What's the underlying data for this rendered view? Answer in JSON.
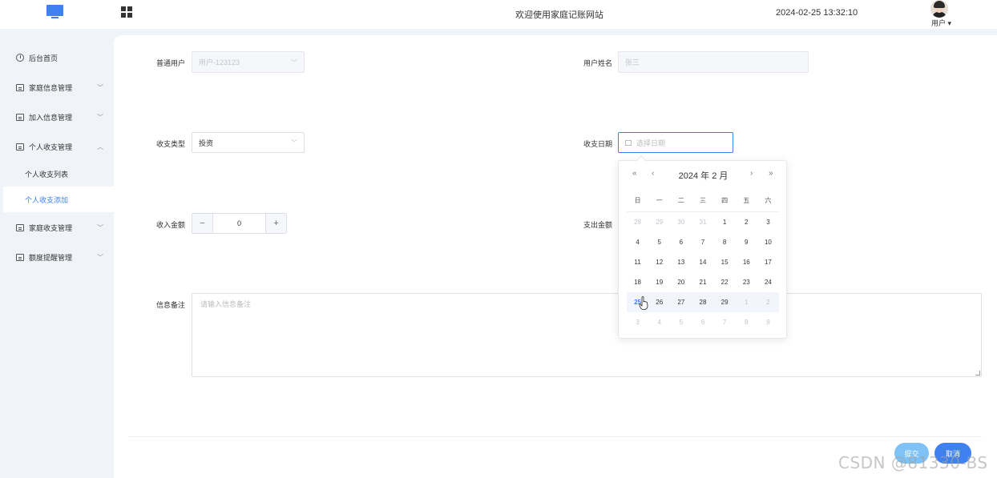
{
  "header": {
    "welcome": "欢迎使用家庭记账网站",
    "datetime": "2024-02-25 13:32:10",
    "user_label": "用户 ▾"
  },
  "sidebar": {
    "items": [
      {
        "label": "后台首页",
        "icon": "clock-icon"
      },
      {
        "label": "家庭信息管理",
        "icon": "card-icon",
        "chevron": "﹀"
      },
      {
        "label": "加入信息管理",
        "icon": "card-icon",
        "chevron": "﹀"
      },
      {
        "label": "个人收支管理",
        "icon": "card-icon",
        "chevron": "︿"
      },
      {
        "label": "家庭收支管理",
        "icon": "card-icon",
        "chevron": "﹀"
      },
      {
        "label": "额度提醒管理",
        "icon": "card-icon",
        "chevron": "﹀"
      }
    ],
    "subitems": [
      {
        "label": "个人收支列表",
        "active": false
      },
      {
        "label": "个人收支添加",
        "active": true
      }
    ]
  },
  "form": {
    "user_label": "普通用户",
    "user_value": "用户-123123",
    "name_label": "用户姓名",
    "name_value": "张三",
    "type_label": "收支类型",
    "type_value": "投资",
    "date_label": "收支日期",
    "date_placeholder": "选择日期",
    "income_label": "收入金额",
    "income_value": "0",
    "income_minus": "−",
    "income_plus": "+",
    "expense_label": "支出金额",
    "note_label": "信息备注",
    "note_placeholder": "请输入信息备注",
    "submit_label": "提交",
    "cancel_label": "取消"
  },
  "datepicker": {
    "header": "2024 年  2 月",
    "nav": {
      "prev_year": "«",
      "prev_month": "‹",
      "next_month": "›",
      "next_year": "»"
    },
    "weekdays": [
      "日",
      "一",
      "二",
      "三",
      "四",
      "五",
      "六"
    ],
    "weeks": [
      [
        [
          "28",
          "prev"
        ],
        [
          "29",
          "prev"
        ],
        [
          "30",
          "prev"
        ],
        [
          "31",
          "prev"
        ],
        [
          "1",
          "cur"
        ],
        [
          "2",
          "cur"
        ],
        [
          "3",
          "cur"
        ]
      ],
      [
        [
          "4",
          "cur"
        ],
        [
          "5",
          "cur"
        ],
        [
          "6",
          "cur"
        ],
        [
          "7",
          "cur"
        ],
        [
          "8",
          "cur"
        ],
        [
          "9",
          "cur"
        ],
        [
          "10",
          "cur"
        ]
      ],
      [
        [
          "11",
          "cur"
        ],
        [
          "12",
          "cur"
        ],
        [
          "13",
          "cur"
        ],
        [
          "14",
          "cur"
        ],
        [
          "15",
          "cur"
        ],
        [
          "16",
          "cur"
        ],
        [
          "17",
          "cur"
        ]
      ],
      [
        [
          "18",
          "cur"
        ],
        [
          "19",
          "cur"
        ],
        [
          "20",
          "cur"
        ],
        [
          "21",
          "cur"
        ],
        [
          "22",
          "cur"
        ],
        [
          "23",
          "cur"
        ],
        [
          "24",
          "cur"
        ]
      ],
      [
        [
          "25",
          "today"
        ],
        [
          "26",
          "cur"
        ],
        [
          "27",
          "cur"
        ],
        [
          "28",
          "cur"
        ],
        [
          "29",
          "cur"
        ],
        [
          "1",
          "next"
        ],
        [
          "2",
          "next"
        ]
      ],
      [
        [
          "3",
          "next"
        ],
        [
          "4",
          "next"
        ],
        [
          "5",
          "next"
        ],
        [
          "6",
          "next"
        ],
        [
          "7",
          "next"
        ],
        [
          "8",
          "next"
        ],
        [
          "9",
          "next"
        ]
      ]
    ],
    "highlight_week": 4
  },
  "watermark": "CSDN @81330-BS",
  "colors": {
    "accent": "#3f81f1",
    "submit": "#7fc2f5"
  }
}
